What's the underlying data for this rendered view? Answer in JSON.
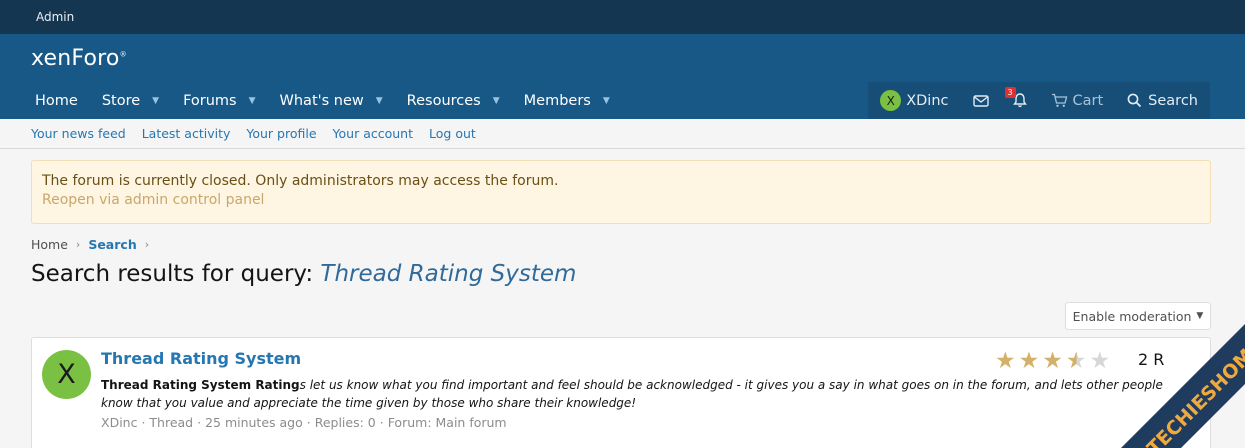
{
  "admin_bar": {
    "label": "Admin"
  },
  "header": {
    "logo": "xenForo"
  },
  "nav": {
    "items": [
      {
        "label": "Home",
        "has_caret": false
      },
      {
        "label": "Store",
        "has_caret": true
      },
      {
        "label": "Forums",
        "has_caret": true
      },
      {
        "label": "What's new",
        "has_caret": true
      },
      {
        "label": "Resources",
        "has_caret": true
      },
      {
        "label": "Members",
        "has_caret": true
      }
    ],
    "user": {
      "avatar_letter": "X",
      "name": "XDinc"
    },
    "alerts_count": "3",
    "cart_label": "Cart",
    "search_label": "Search"
  },
  "subnav": {
    "links": [
      "Your news feed",
      "Latest activity",
      "Your profile",
      "Your account",
      "Log out"
    ]
  },
  "notice": {
    "message": "The forum is currently closed. Only administrators may access the forum.",
    "link": "Reopen via admin control panel"
  },
  "breadcrumb": {
    "home": "Home",
    "current": "Search"
  },
  "page": {
    "title_prefix": "Search results for query: ",
    "query": "Thread Rating System"
  },
  "moderation_button": "Enable moderation",
  "result": {
    "avatar_letter": "X",
    "title": "Thread Rating System",
    "snippet_bold": "Thread Rating System Rating",
    "snippet_rest": "s let us know what you find important and feel should be acknowledged - it gives you a say in what goes on in the forum, and lets other people know that you value and appreciate the time given by those who share their knowledge!",
    "meta": {
      "author": "XDinc",
      "type": "Thread",
      "time": "25 minutes ago",
      "replies": "Replies: 0",
      "forum": "Forum: Main forum"
    },
    "rating": 3.5,
    "rating_count_text": "2 R"
  },
  "watermark": {
    "text": "TECHIESHOME.COM"
  },
  "colors": {
    "nav_bg": "#185886",
    "admin_bg": "#143651",
    "link": "#2577b1",
    "avatar": "#7ac043",
    "star": "#d4b16a",
    "watermark_stripe": "#1f3c5f",
    "watermark_text": "#f2a93b"
  }
}
